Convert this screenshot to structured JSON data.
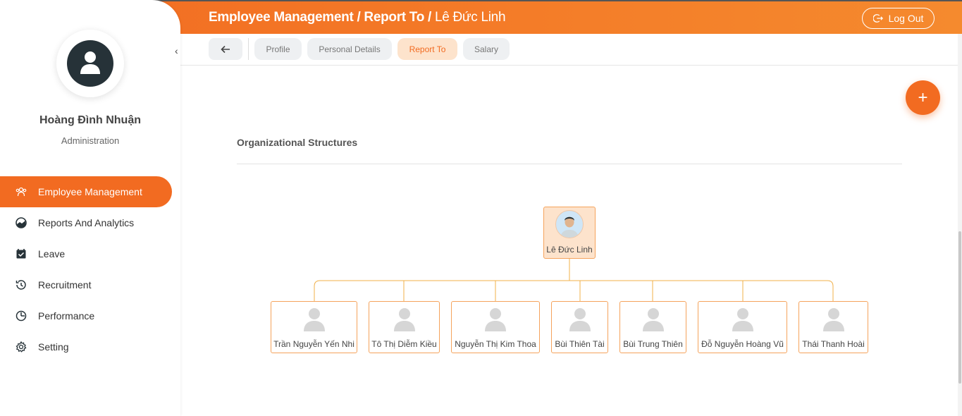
{
  "header": {
    "breadcrumb_main": "Employee Management / Report To /",
    "breadcrumb_name": "Lê Đức Linh",
    "logout_label": "Log Out"
  },
  "sidebar": {
    "user_name": "Hoàng Đình Nhuận",
    "user_role": "Administration",
    "collapse_icon": "‹",
    "items": [
      {
        "label": "Employee Management",
        "icon": "users-icon",
        "active": true
      },
      {
        "label": "Reports And Analytics",
        "icon": "chart-icon",
        "active": false
      },
      {
        "label": "Leave",
        "icon": "calendar-check-icon",
        "active": false
      },
      {
        "label": "Recruitment",
        "icon": "recruitment-icon",
        "active": false
      },
      {
        "label": "Performance",
        "icon": "performance-icon",
        "active": false
      },
      {
        "label": "Setting",
        "icon": "gear-icon",
        "active": false
      }
    ]
  },
  "tabs": {
    "items": [
      {
        "label": "Profile",
        "active": false
      },
      {
        "label": "Personal Details",
        "active": false
      },
      {
        "label": "Report To",
        "active": true
      },
      {
        "label": "Salary",
        "active": false
      }
    ]
  },
  "main": {
    "add_label": "+",
    "section_title": "Organizational Structures"
  },
  "org": {
    "root": {
      "name": "Lê Đức Linh",
      "icon": "employee-photo"
    },
    "children": [
      {
        "name": "Trần Nguyễn Yến Nhi"
      },
      {
        "name": "Tô Thị Diễm Kiều"
      },
      {
        "name": "Nguyễn Thị Kim Thoa"
      },
      {
        "name": "Bùi Thiên Tài"
      },
      {
        "name": "Bùi Trung Thiên"
      },
      {
        "name": "Đỗ Nguyễn Hoàng Vũ"
      },
      {
        "name": "Thái Thanh Hoài"
      }
    ]
  },
  "colors": {
    "accent": "#f26b21",
    "accent_light": "#fde3cc",
    "org_line": "#f0b04a",
    "node_border": "#f5a35c"
  }
}
